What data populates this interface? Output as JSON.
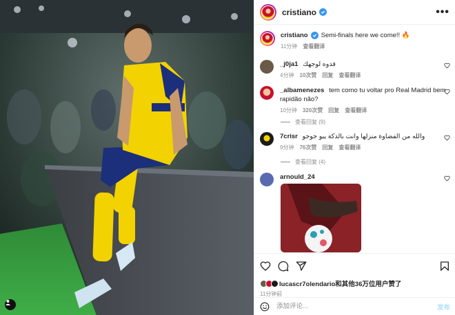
{
  "header": {
    "username": "cristiano",
    "more_label": "•••"
  },
  "caption": {
    "username": "cristiano",
    "text": "Semi-finals here we come!! 🔥",
    "time": "11分钟",
    "translate": "查看翻译"
  },
  "comments": [
    {
      "username": "_j0ja1",
      "text": "قدوه لوجهك",
      "time": "4分钟",
      "likes": "10次赞",
      "reply": "回复",
      "translate": "查看翻译",
      "avatar_color": "#6b5a48"
    },
    {
      "username": "_albamenezes",
      "text": "tem como tu voltar pro Real Madrid bem rapidão não?",
      "time": "10分钟",
      "likes": "320次赞",
      "reply": "回复",
      "translate": "查看翻译",
      "avatar_color": "#c8102e",
      "view_replies": "查看回复 (9)"
    },
    {
      "username": "7crisr",
      "text": "والله من الفضاوة منزلها وانت بالدكة يبو جوجو",
      "time": "9分钟",
      "likes": "76次赞",
      "reply": "回复",
      "translate": "查看翻译",
      "avatar_color": "#1b1b1b",
      "view_replies": "查看回复 (4)"
    },
    {
      "username": "arnould_24",
      "text": "",
      "avatar_color": "#5a6ab0"
    }
  ],
  "actions": {
    "likes_text": "lucascr7olendario和其他36万位用户赞了",
    "time": "11分钟前"
  },
  "add_comment": {
    "placeholder": "添加评论...",
    "post_label": "发布"
  },
  "colors": {
    "brand_blue": "#3897f0",
    "post_disabled": "#b2dffc",
    "kit_yellow": "#f2d200",
    "kit_navy": "#1c2f7a"
  },
  "icons": [
    "heart-icon",
    "comment-icon",
    "share-icon",
    "bookmark-icon",
    "emoji-icon",
    "verified-icon",
    "more-icon",
    "user-icon"
  ]
}
